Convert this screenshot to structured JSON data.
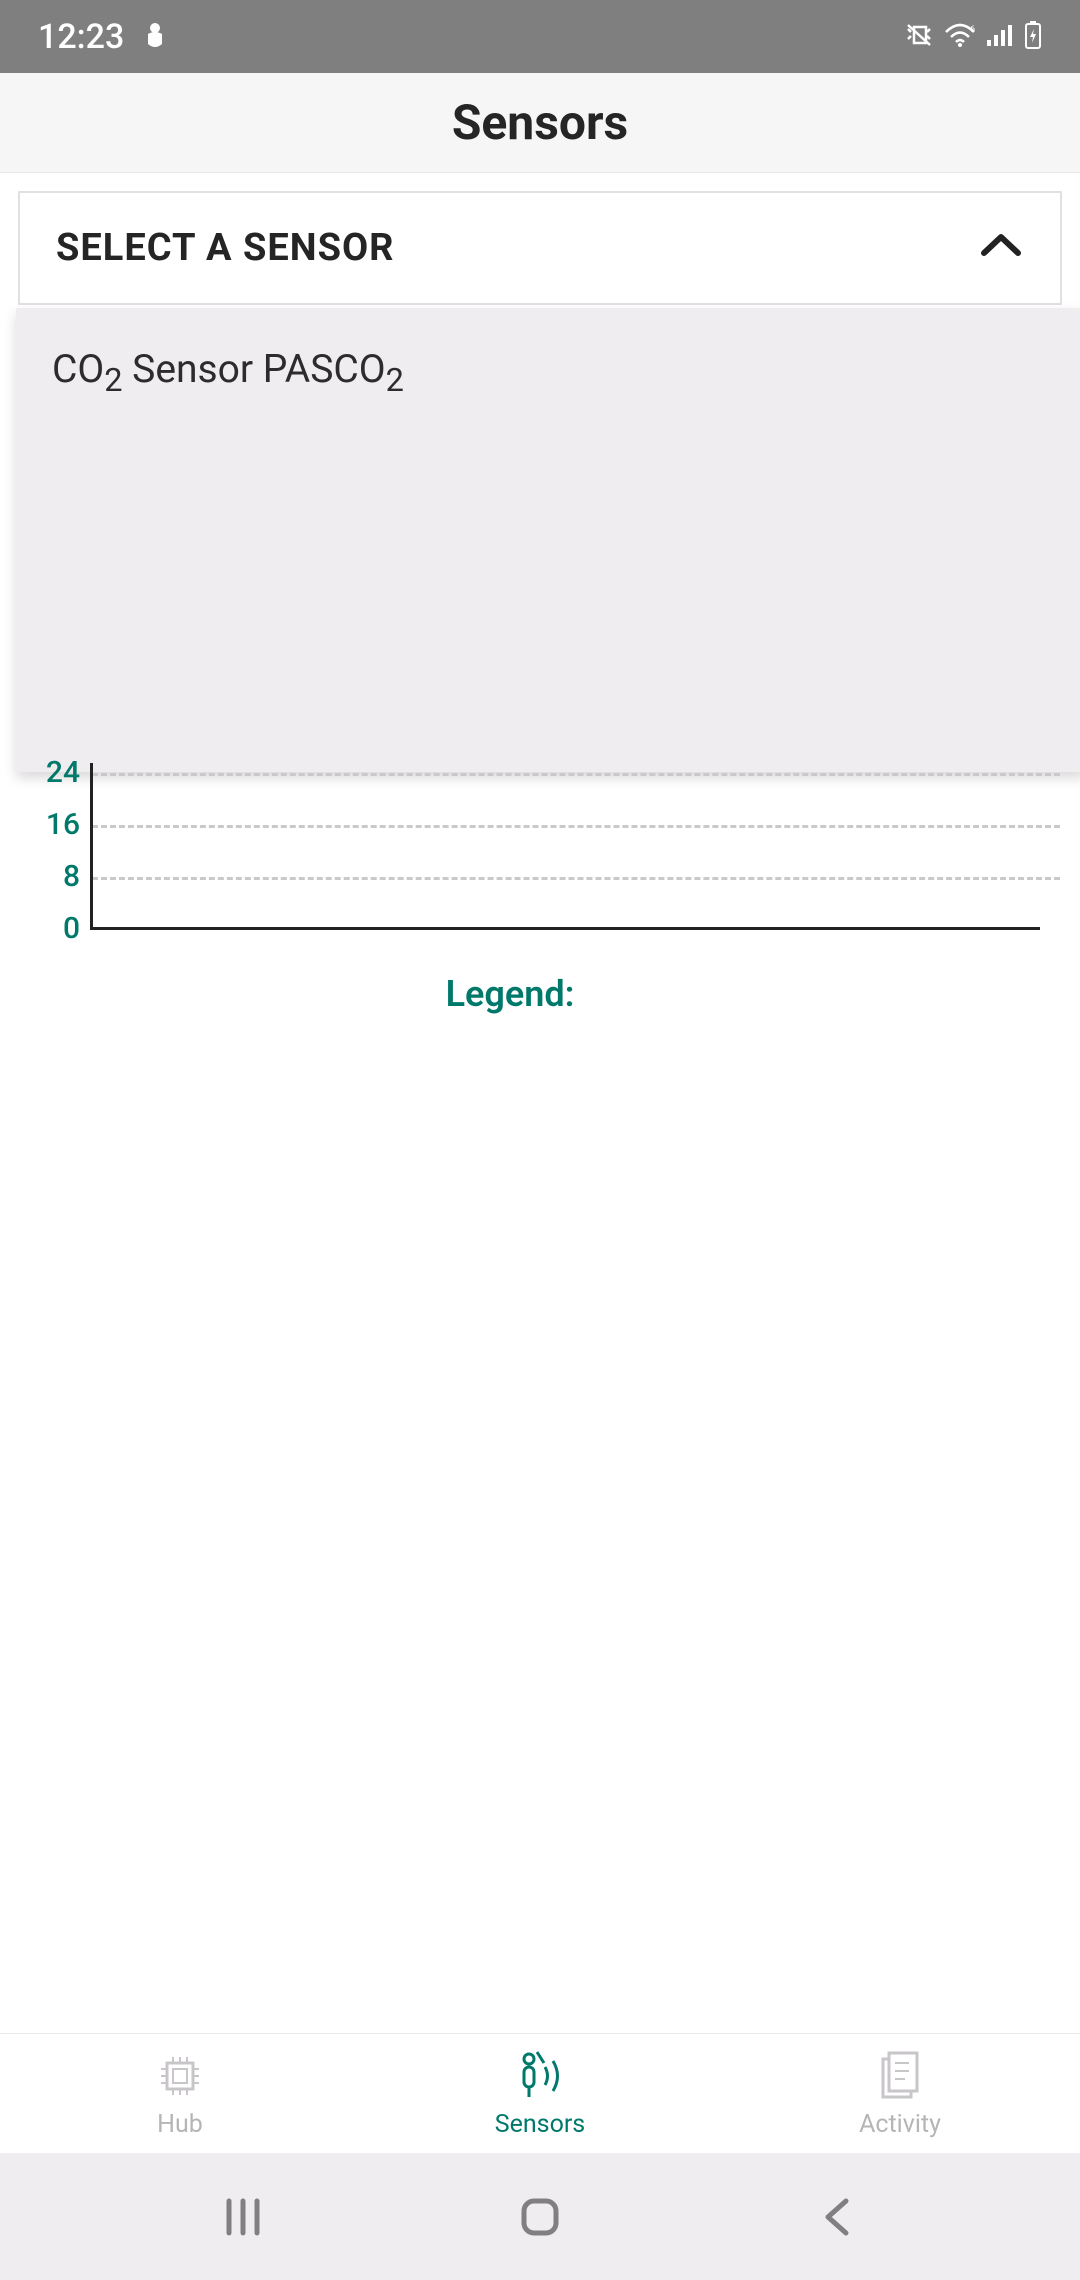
{
  "status": {
    "time": "12:23",
    "icons": {
      "app": "app-indicator-icon",
      "vibrate": "vibrate-icon",
      "wifi": "wifi-icon",
      "signal": "signal-icon",
      "battery": "battery-charging-icon"
    }
  },
  "header": {
    "title": "Sensors"
  },
  "select": {
    "label": "SELECT A SENSOR",
    "expanded": true,
    "options": [
      {
        "label_html": "CO<sub>2</sub> Sensor PASCO<sub>2</sub>",
        "label_plain": "CO2 Sensor PASCO2"
      }
    ]
  },
  "chart_data": {
    "type": "line",
    "title": "",
    "xlabel": "",
    "ylabel": "",
    "y_ticks_visible": [
      24,
      16,
      8,
      0
    ],
    "ylim": [
      0,
      40
    ],
    "x": [],
    "series": [],
    "legend_title": "Legend:",
    "grid": true
  },
  "tabs": [
    {
      "id": "hub",
      "label": "Hub",
      "icon": "chip-icon",
      "active": false
    },
    {
      "id": "sensors",
      "label": "Sensors",
      "icon": "sensor-person-icon",
      "active": true
    },
    {
      "id": "activity",
      "label": "Activity",
      "icon": "document-icon",
      "active": false
    }
  ],
  "system_nav": {
    "recent": "recent-apps-icon",
    "home": "home-icon",
    "back": "back-icon"
  },
  "colors": {
    "accent": "#00796b",
    "inactive": "#b6b4b6",
    "statusbar": "#7f7f7f"
  }
}
